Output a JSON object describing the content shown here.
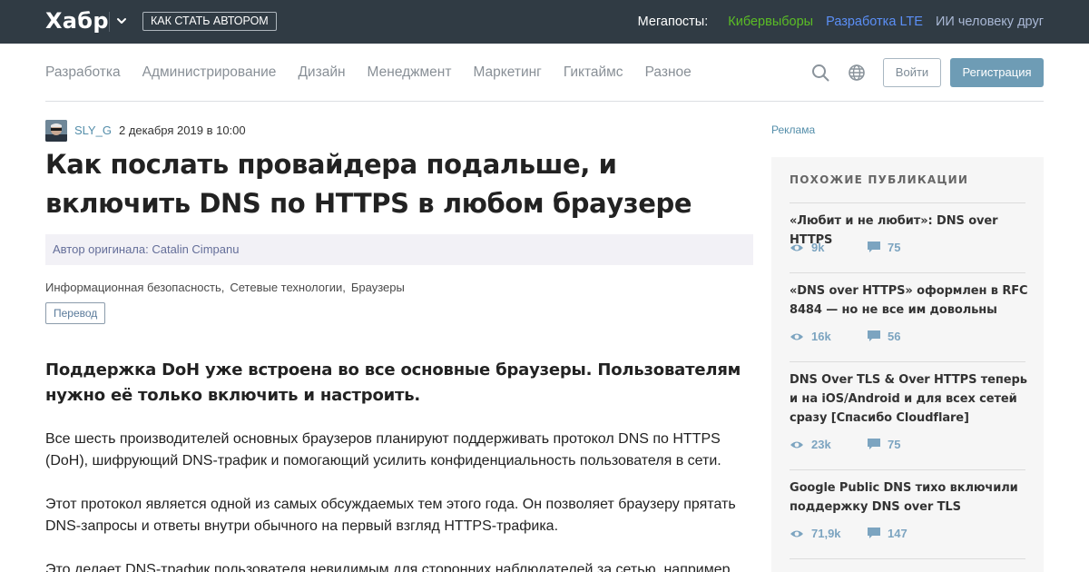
{
  "header": {
    "logo": "Хабр",
    "author_button": "Как стать автором",
    "megaposts_label": "Мегапосты:",
    "megaposts": [
      {
        "label": "Кибервыборы",
        "color": "#5bbd25"
      },
      {
        "label": "Разработка LTE",
        "color": "#5b8ff6"
      },
      {
        "label": "ИИ человеку друг",
        "color": "#a9b8d5"
      }
    ]
  },
  "nav": {
    "hubs": [
      "Разработка",
      "Администрирование",
      "Дизайн",
      "Менеджмент",
      "Маркетинг",
      "Гиктаймс",
      "Разное"
    ],
    "login": "Войти",
    "register": "Регистрация"
  },
  "article": {
    "author": "SLY_G",
    "date": "2 декабря 2019 в 10:00",
    "title": "Как послать провайдера подальше, и включить DNS по HTTPS в любом браузере",
    "original_author": "Автор оригинала: Catalin Cimpanu",
    "tags": [
      "Информационная безопасность,",
      "Сетевые технологии,",
      "Браузеры"
    ],
    "badge": "Перевод",
    "lead": "Поддержка DoH уже встроена во все основные браузеры. Пользователям нужно её только включить и настроить.",
    "paragraphs": [
      "Все шесть производителей основных браузеров планируют поддерживать протокол DNS по HTTPS (DoH), шифрующий DNS-трафик и помогающий усилить конфиденциальность пользователя в сети.",
      "Этот протокол является одной из самых обсуждаемых тем этого года. Он позволяет браузеру прятать DNS-запросы и ответы внутри обычного на первый взгляд HTTPS-трафика.",
      "Это делает DNS-трафик пользователя невидимым для сторонних наблюдателей за сетью, например"
    ]
  },
  "sidebar": {
    "ad_label": "Реклама",
    "title": "Похожие публикации",
    "publications": [
      {
        "title": "«Любит и не любит»: DNS over HTTPS",
        "views": "9k",
        "comments": "75"
      },
      {
        "title": "«DNS over HTTPS» оформлен в RFC 8484 — но не все им довольны",
        "views": "16k",
        "comments": "56"
      },
      {
        "title": "DNS Over TLS & Over HTTPS теперь и на iOS/Android и для всех сетей сразу [Спасибо Cloudflare]",
        "views": "23k",
        "comments": "75"
      },
      {
        "title": "Google Public DNS тихо включили поддержку DNS over TLS",
        "views": "71,9k",
        "comments": "147"
      }
    ]
  }
}
